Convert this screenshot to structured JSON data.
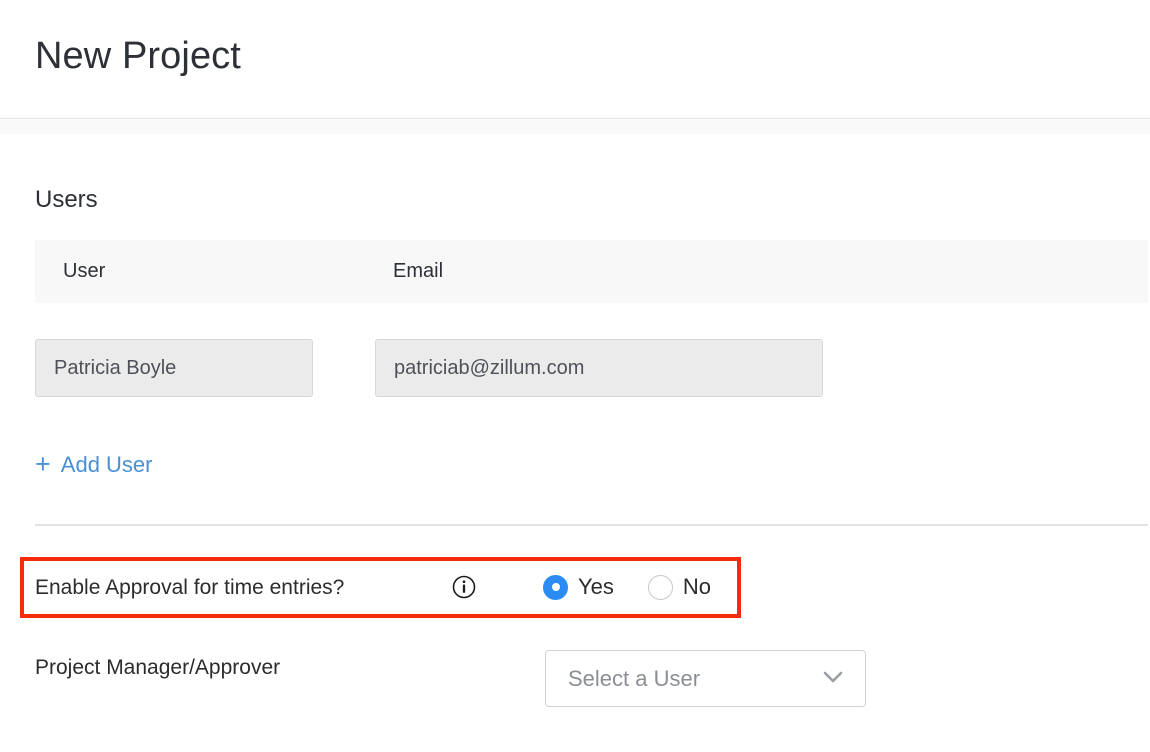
{
  "header": {
    "title": "New Project"
  },
  "users_section": {
    "heading": "Users",
    "table": {
      "columns": [
        "User",
        "Email"
      ],
      "rows": [
        {
          "user": "Patricia Boyle",
          "email": "patriciab@zillum.com"
        }
      ]
    },
    "add_user": {
      "plus": "+",
      "label": "Add User"
    }
  },
  "approval_row": {
    "label": "Enable Approval for time entries?",
    "info_icon": "info-icon",
    "options": [
      {
        "label": "Yes",
        "selected": true
      },
      {
        "label": "No",
        "selected": false
      }
    ],
    "highlight_color": "#f52b0c"
  },
  "approver_row": {
    "label": "Project Manager/Approver",
    "select": {
      "value": "Select a User",
      "chevron": "chevron-down-icon"
    }
  },
  "colors": {
    "accent_blue": "#4a90d4",
    "radio_blue": "#2b8cf5",
    "highlight_red": "#f52b0c",
    "text_dark": "#2e3038",
    "field_bg": "#ebebec",
    "header_band": "#f8f8f9"
  }
}
